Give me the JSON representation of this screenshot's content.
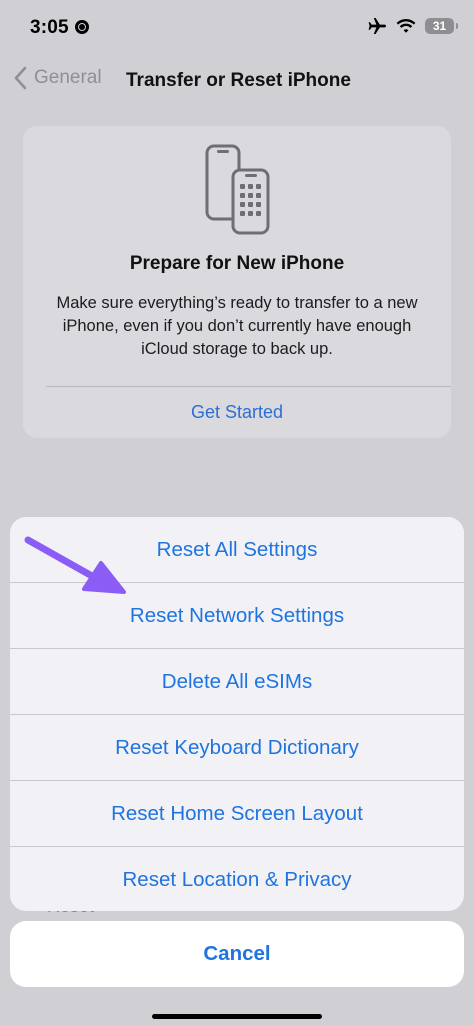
{
  "status_bar": {
    "time": "3:05",
    "battery_level": "31"
  },
  "nav": {
    "back_label": "General",
    "title": "Transfer or Reset iPhone"
  },
  "prepare_card": {
    "title": "Prepare for New iPhone",
    "description": "Make sure everything’s ready to transfer to a new iPhone, even if you don’t currently have enough iCloud storage to back up.",
    "action_label": "Get Started"
  },
  "background_row": {
    "label": "Reset"
  },
  "action_sheet": {
    "items": [
      {
        "label": "Reset All Settings"
      },
      {
        "label": "Reset Network Settings"
      },
      {
        "label": "Delete All eSIMs"
      },
      {
        "label": "Reset Keyboard Dictionary"
      },
      {
        "label": "Reset Home Screen Layout"
      },
      {
        "label": "Reset Location & Privacy"
      }
    ],
    "cancel_label": "Cancel"
  },
  "colors": {
    "accent": "#1f74e0",
    "arrow": "#8b5cf6"
  }
}
